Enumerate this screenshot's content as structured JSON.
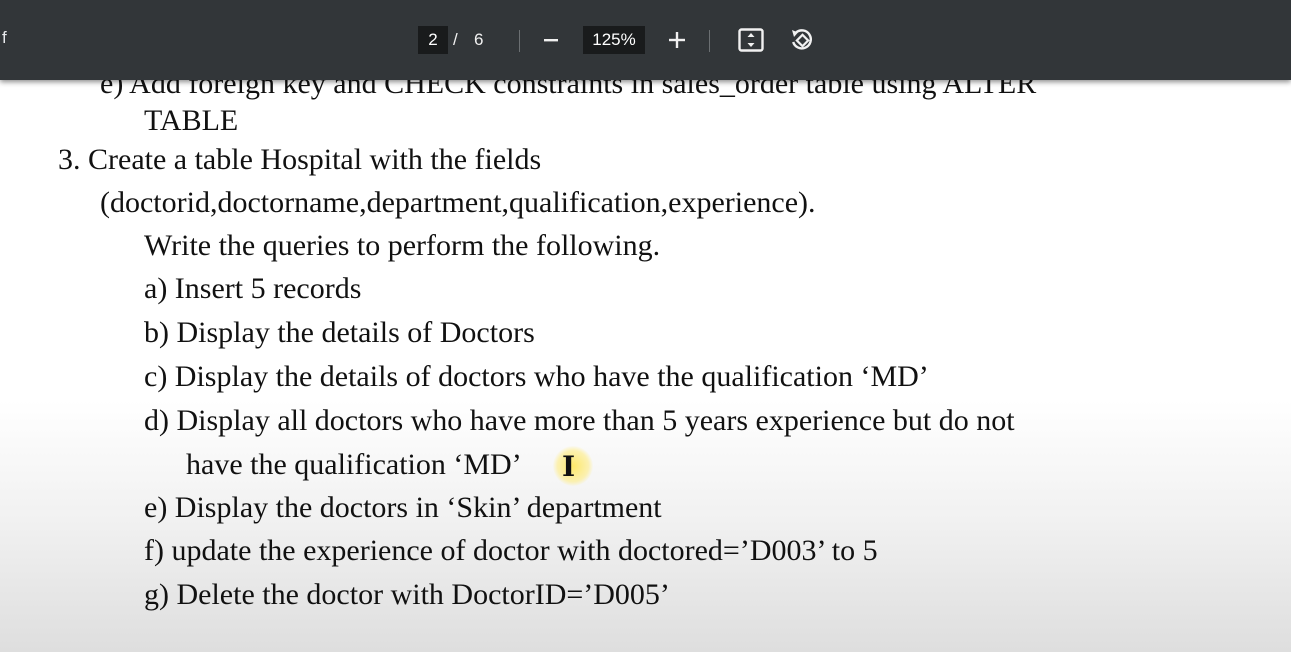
{
  "toolbar": {
    "title": "f",
    "current_page": "2",
    "page_separator": "/",
    "total_pages": "6",
    "zoom": "125%"
  },
  "document": {
    "lines": [
      "e)  Add foreign key and CHECK constraints in sales_order table using ALTER",
      "TABLE",
      "3.  Create a table Hospital with the fields",
      "(doctorid,doctorname,department,qualification,experience).",
      "Write the queries to perform the following.",
      "a)  Insert 5 records",
      "b)  Display the details of Doctors",
      "c)  Display the details of doctors who have the qualification ‘MD’",
      "d)  Display all doctors who have more than 5 years experience but do not",
      "have the qualification ‘MD’",
      "e)  Display the doctors in ‘Skin’ department",
      "f)  update the experience of doctor with doctored=’D003’ to 5",
      "g)  Delete the doctor with DoctorID=’D005’"
    ]
  },
  "cursor": {
    "glyph": "I"
  },
  "icons": {
    "zoom_out": "minus-icon",
    "zoom_in": "plus-icon",
    "fit_page": "fit-page-icon",
    "rotate": "rotate-icon"
  }
}
